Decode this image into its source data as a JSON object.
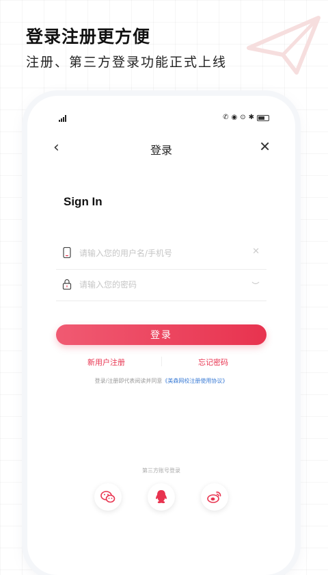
{
  "promo": {
    "title": "登录注册更方便",
    "subtitle": "注册、第三方登录功能正式上线"
  },
  "nav": {
    "title": "登录"
  },
  "form": {
    "heading": "Sign In",
    "username_placeholder": "请输入您的用户名/手机号",
    "password_placeholder": "请输入您的密码",
    "login_label": "登录"
  },
  "links": {
    "register": "新用户注册",
    "forgot": "忘记密码"
  },
  "agreement": {
    "prefix": "登录/注册即代表阅读并同意",
    "link": "《美森网校注册使用协议》"
  },
  "third_party": {
    "label": "第三方账号登录",
    "providers": [
      "wechat",
      "qq",
      "weibo"
    ]
  },
  "colors": {
    "accent": "#e8334f",
    "link_blue": "#3a7bd5"
  }
}
